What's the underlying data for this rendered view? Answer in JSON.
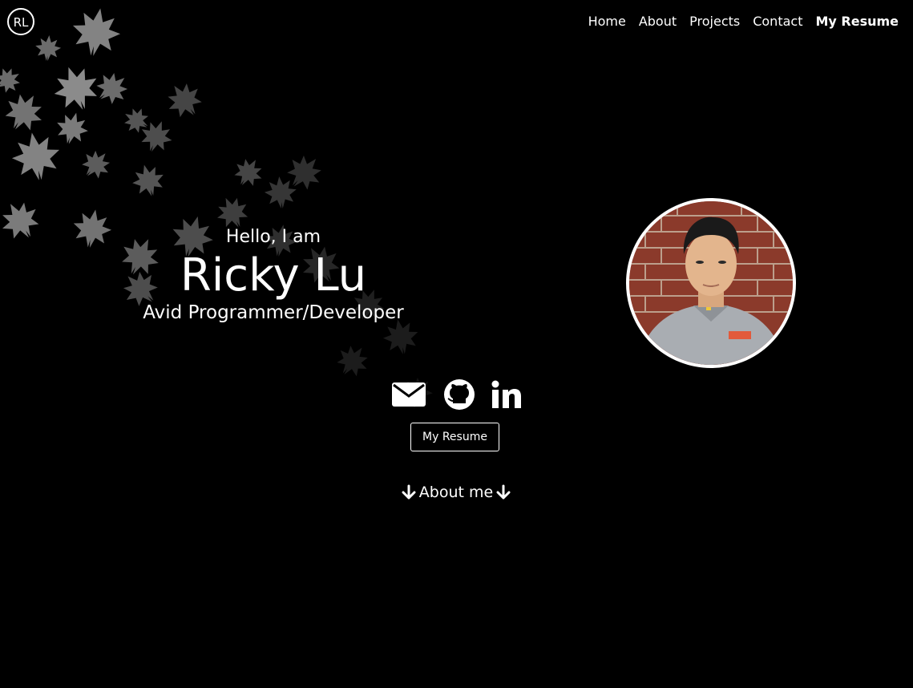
{
  "nav": {
    "logo_text": "RL",
    "items": [
      {
        "label": "Home"
      },
      {
        "label": "About"
      },
      {
        "label": "Projects"
      },
      {
        "label": "Contact"
      },
      {
        "label": "My Resume"
      }
    ]
  },
  "hero": {
    "greeting": "Hello, I am",
    "name": "Ricky Lu",
    "role": "Avid Programmer/Developer"
  },
  "social": {
    "icons": [
      "envelope-icon",
      "github-icon",
      "linkedin-icon"
    ]
  },
  "resume_button": {
    "label": "My Resume"
  },
  "about_link": {
    "label": "About me"
  },
  "colors": {
    "background": "#000000",
    "text": "#ffffff",
    "leaf": "#9a9a9a"
  }
}
